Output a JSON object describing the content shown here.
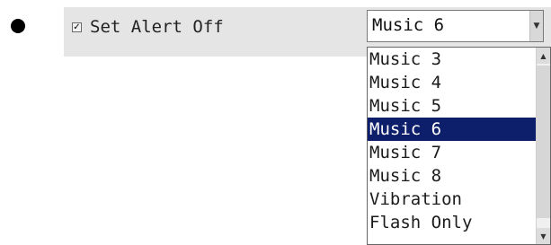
{
  "setting": {
    "checkbox_checked": true,
    "checkbox_mark": "✓",
    "label": "Set Alert Off",
    "selected_value": "Music 6"
  },
  "dropdown": {
    "items": [
      {
        "label": "Music 3",
        "selected": false
      },
      {
        "label": "Music 4",
        "selected": false
      },
      {
        "label": "Music 5",
        "selected": false
      },
      {
        "label": "Music 6",
        "selected": true
      },
      {
        "label": "Music 7",
        "selected": false
      },
      {
        "label": "Music 8",
        "selected": false
      },
      {
        "label": "Vibration",
        "selected": false
      },
      {
        "label": "Flash Only",
        "selected": false
      }
    ]
  },
  "icons": {
    "combo_arrow": "chevron-down-icon",
    "scroll_up": "scroll-up-icon",
    "scroll_down": "scroll-down-icon"
  },
  "colors": {
    "selection_bg": "#0d1f6b",
    "selection_fg": "#ffffff",
    "panel_bg": "#e5e5e5"
  }
}
